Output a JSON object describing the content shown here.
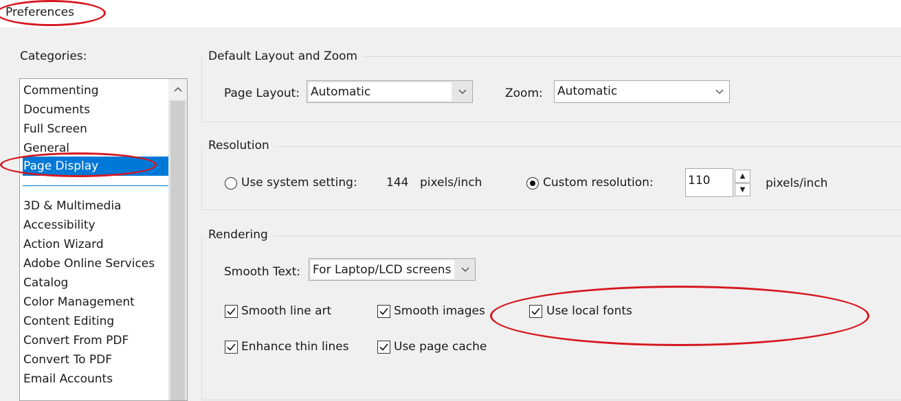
{
  "window": {
    "title": "Preferences"
  },
  "categories": {
    "label": "Categories:",
    "items": [
      "Commenting",
      "Documents",
      "Full Screen",
      "General",
      "Page Display",
      "3D & Multimedia",
      "Accessibility",
      "Action Wizard",
      "Adobe Online Services",
      "Catalog",
      "Color Management",
      "Content Editing",
      "Convert From PDF",
      "Convert To PDF",
      "Email Accounts"
    ],
    "selected": "Page Display"
  },
  "layout_zoom": {
    "title": "Default Layout and Zoom",
    "page_layout_label": "Page Layout:",
    "page_layout_value": "Automatic",
    "zoom_label": "Zoom:",
    "zoom_value": "Automatic"
  },
  "resolution": {
    "title": "Resolution",
    "system_label": "Use system setting:",
    "system_value": "144",
    "system_unit": "pixels/inch",
    "custom_label": "Custom resolution:",
    "custom_value": "110",
    "custom_unit": "pixels/inch",
    "selected": "custom"
  },
  "rendering": {
    "title": "Rendering",
    "smooth_text_label": "Smooth Text:",
    "smooth_text_value": "For Laptop/LCD screens",
    "checkboxes": {
      "smooth_line_art": {
        "label": "Smooth line art",
        "checked": true
      },
      "smooth_images": {
        "label": "Smooth images",
        "checked": true
      },
      "use_local_fonts": {
        "label": "Use local fonts",
        "checked": true
      },
      "enhance_thin_lines": {
        "label": "Enhance thin lines",
        "checked": true
      },
      "use_page_cache": {
        "label": "Use page cache",
        "checked": true
      }
    }
  },
  "annotation_color": "#d7161f",
  "accent_color": "#0078d7"
}
